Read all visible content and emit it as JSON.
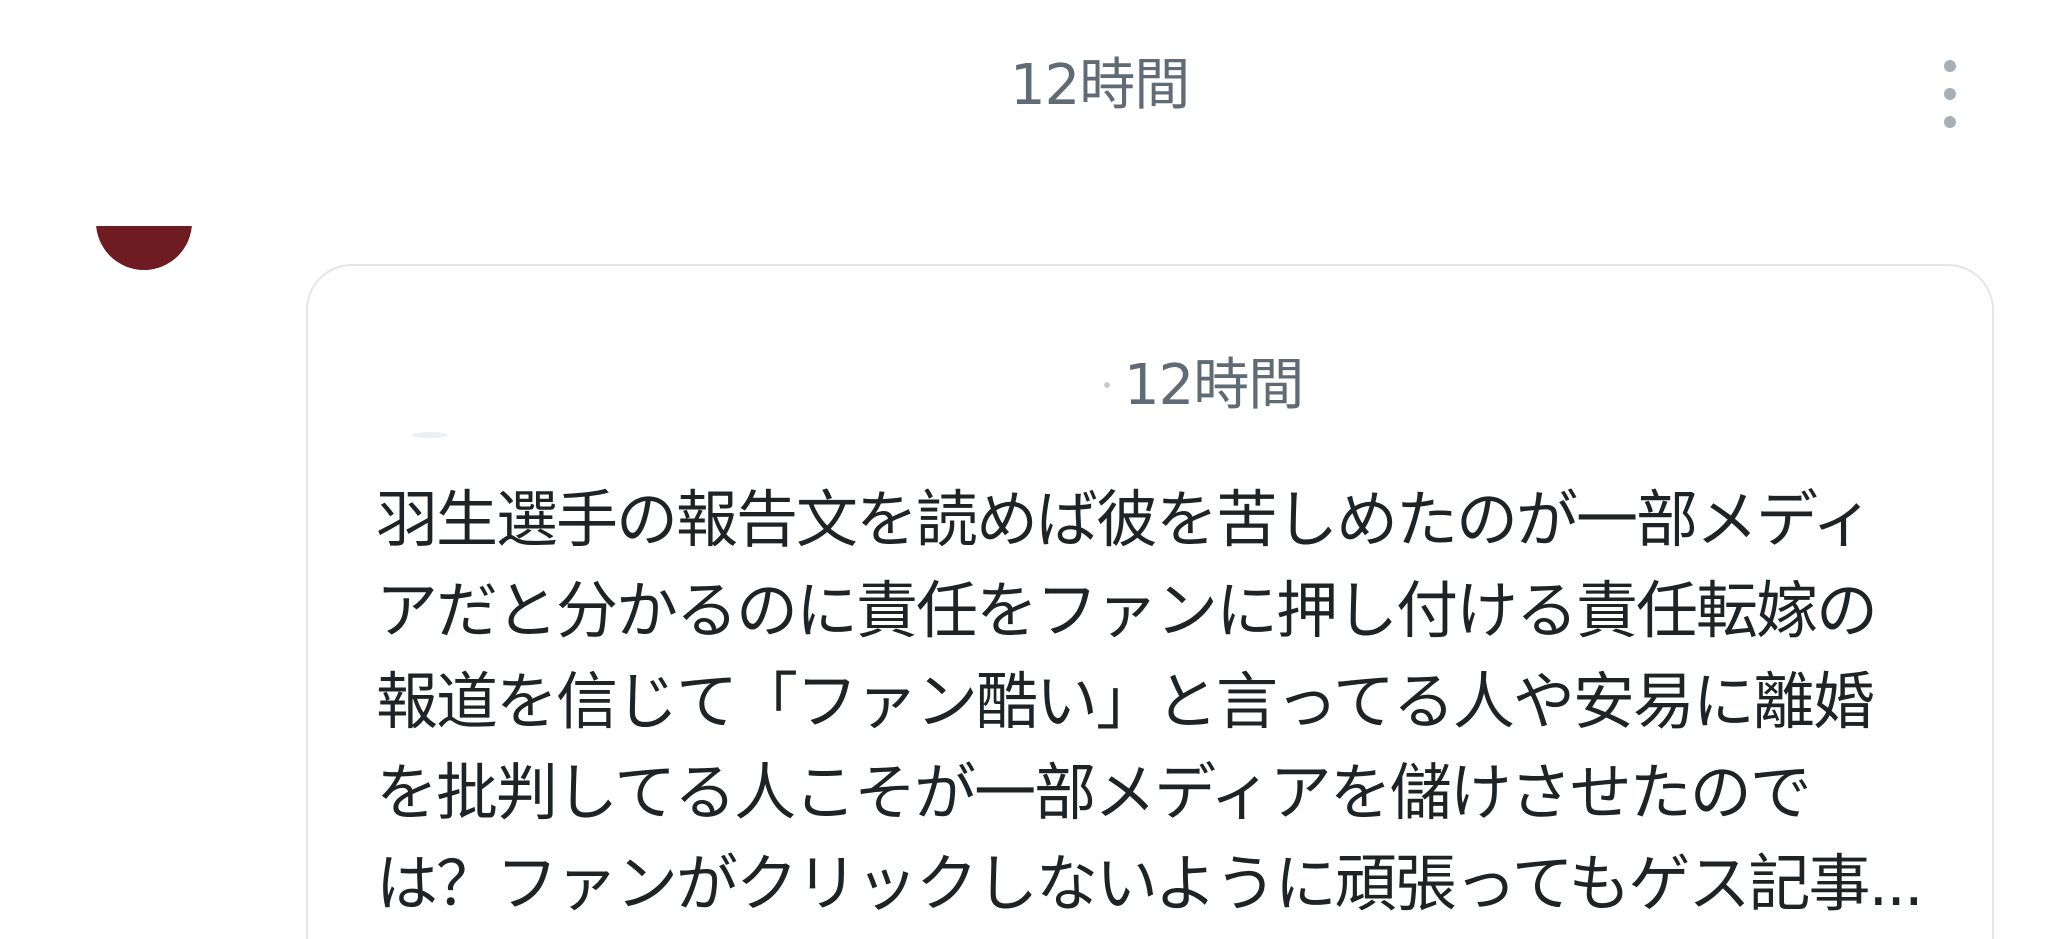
{
  "header": {
    "timestamp": "12時間",
    "more_icon": "more-vertical-icon"
  },
  "reply": {
    "timestamp": "12時間",
    "body": "羽生選手の報告文を読めば彼を苦しめたのが一部メディ\nアだと分かるのに責任をファンに押し付ける責任転嫁の\n報道を信じて「ファン酷い」と言ってる人や安易に離婚\nを批判してる人こそが一部メディアを儲けさせたので\nは？ファンがクリックしないように頑張ってもゲス記事..."
  },
  "colors": {
    "timestamp": "#5f6b75",
    "body_text": "#1f2326",
    "card_border": "#e3e6e9",
    "icon": "#a7b0b8",
    "avatar": "#6e1b22"
  }
}
